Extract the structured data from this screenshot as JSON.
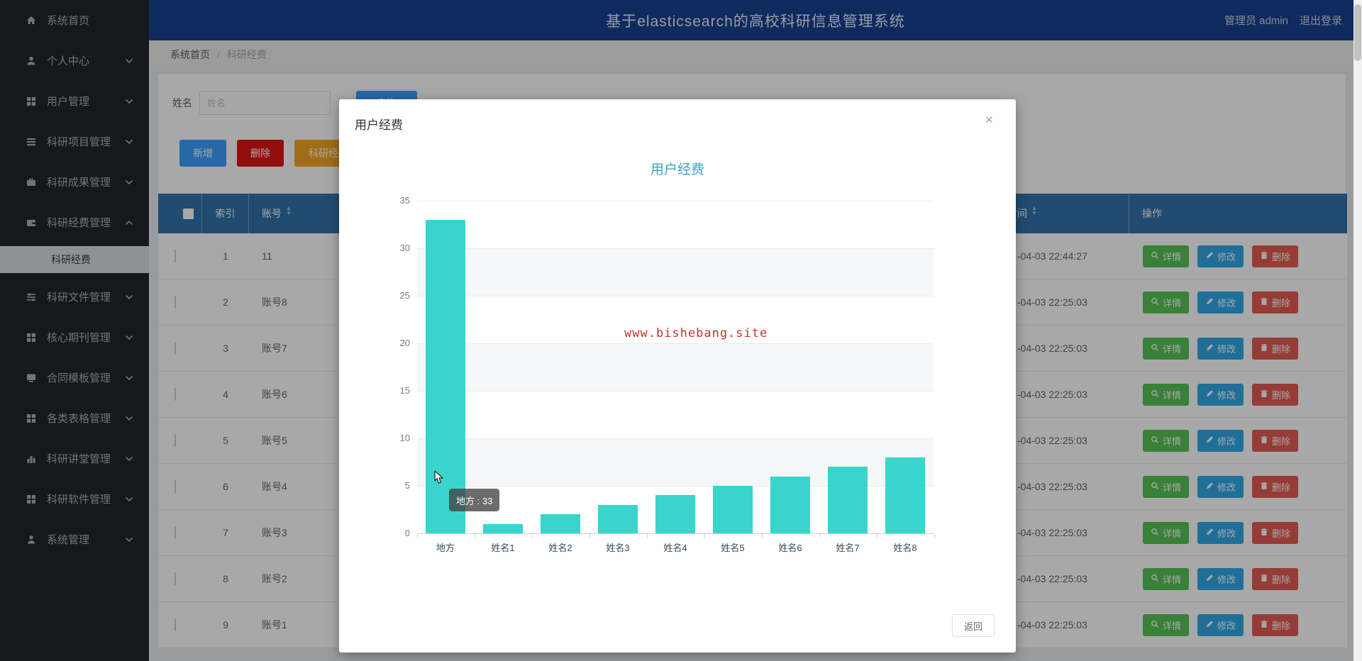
{
  "app": {
    "title": "基于elasticsearch的高校科研信息管理系统",
    "user_role_name": "管理员 admin",
    "logout_label": "退出登录"
  },
  "sidebar": {
    "items": [
      {
        "label": "系统首页",
        "icon": "home-icon",
        "chevron": "none"
      },
      {
        "label": "个人中心",
        "icon": "user-icon",
        "chevron": "down"
      },
      {
        "label": "用户管理",
        "icon": "grid-icon",
        "chevron": "down"
      },
      {
        "label": "科研项目管理",
        "icon": "list-icon",
        "chevron": "down"
      },
      {
        "label": "科研成果管理",
        "icon": "briefcase-icon",
        "chevron": "down"
      },
      {
        "label": "科研经费管理",
        "icon": "wallet-icon",
        "chevron": "up",
        "expanded": true,
        "children": [
          {
            "label": "科研经费",
            "active": true
          }
        ]
      },
      {
        "label": "科研文件管理",
        "icon": "sliders-icon",
        "chevron": "down"
      },
      {
        "label": "核心期刊管理",
        "icon": "grid-icon",
        "chevron": "down"
      },
      {
        "label": "合同模板管理",
        "icon": "monitor-icon",
        "chevron": "down"
      },
      {
        "label": "各类表格管理",
        "icon": "grid-icon",
        "chevron": "down"
      },
      {
        "label": "科研讲堂管理",
        "icon": "bar-chart-icon",
        "chevron": "down"
      },
      {
        "label": "科研软件管理",
        "icon": "grid-icon",
        "chevron": "down"
      },
      {
        "label": "系统管理",
        "icon": "person-icon",
        "chevron": "down"
      }
    ]
  },
  "breadcrumb": {
    "root": "系统首页",
    "separator": "/",
    "current": "科研经费"
  },
  "filter": {
    "label": "姓名",
    "placeholder": "姓名",
    "query_label": "查询"
  },
  "toolbar": {
    "add_label": "新增",
    "delete_label": "删除",
    "stat_label": "科研经费"
  },
  "table": {
    "headers": {
      "index": "索引",
      "account": "账号",
      "time": "时间",
      "actions": "操作"
    },
    "action_labels": {
      "detail": "详情",
      "edit": "修改",
      "delete": "删除"
    },
    "rows": [
      {
        "index": "1",
        "account": "11",
        "time": "-04-03 22:44:27"
      },
      {
        "index": "2",
        "account": "账号8",
        "time": "-04-03 22:25:03"
      },
      {
        "index": "3",
        "account": "账号7",
        "time": "-04-03 22:25:03"
      },
      {
        "index": "4",
        "account": "账号6",
        "time": "-04-03 22:25:03"
      },
      {
        "index": "5",
        "account": "账号5",
        "time": "-04-03 22:25:03"
      },
      {
        "index": "6",
        "account": "账号4",
        "time": "-04-03 22:25:03"
      },
      {
        "index": "7",
        "account": "账号3",
        "time": "-04-03 22:25:03"
      },
      {
        "index": "8",
        "account": "账号2",
        "time": "-04-03 22:25:03"
      },
      {
        "index": "9",
        "account": "账号1",
        "time": "-04-03 22:25:03"
      }
    ]
  },
  "modal": {
    "title": "用户经费",
    "close_glyph": "×",
    "back_label": "返回",
    "watermark": "www.bishebang.site",
    "tooltip_text": "地方 : 33"
  },
  "chart_data": {
    "type": "bar",
    "title": "用户经费",
    "categories": [
      "地方",
      "姓名1",
      "姓名2",
      "姓名3",
      "姓名4",
      "姓名5",
      "姓名6",
      "姓名7",
      "姓名8"
    ],
    "values": [
      33,
      1,
      2,
      3,
      4,
      5,
      6,
      7,
      8
    ],
    "xlabel": "",
    "ylabel": "",
    "ylim": [
      0,
      35
    ],
    "ytick_step": 5,
    "grid": true,
    "legend_position": "none",
    "bar_color": "#39d5cd",
    "title_color": "#3ca4c4"
  }
}
